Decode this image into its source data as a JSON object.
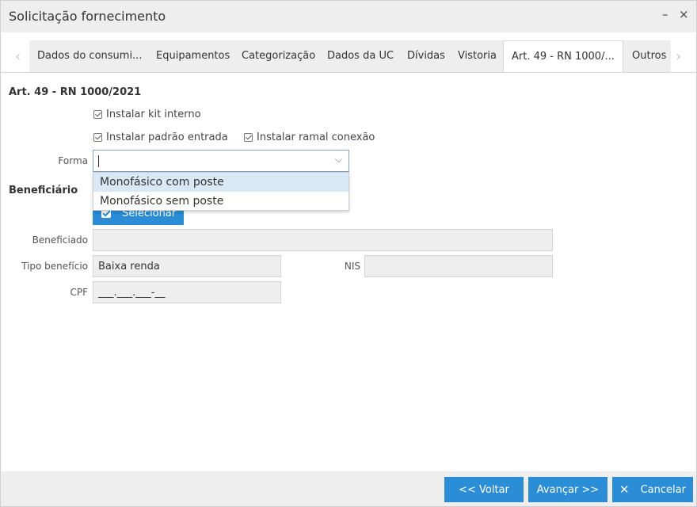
{
  "window": {
    "title": "Solicitação fornecimento",
    "minimize_glyph": "–",
    "close_glyph": "×"
  },
  "tabs": {
    "prev_glyph": "‹",
    "next_glyph": "›",
    "items": [
      {
        "label": "Dados do consumi..."
      },
      {
        "label": "Equipamentos"
      },
      {
        "label": "Categorização"
      },
      {
        "label": "Dados da UC"
      },
      {
        "label": "Dívidas"
      },
      {
        "label": "Vistoria"
      },
      {
        "label": "Art. 49 - RN 1000/..."
      },
      {
        "label": "Outros"
      }
    ],
    "active_index": 6
  },
  "art49": {
    "section_title": "Art. 49 - RN 1000/2021",
    "checkboxes": [
      {
        "label": "Instalar kit interno",
        "checked": true
      },
      {
        "label": "Instalar padrão entrada",
        "checked": true
      },
      {
        "label": "Instalar ramal conexão",
        "checked": true
      }
    ],
    "forma": {
      "label": "Forma",
      "value": "",
      "chevron_glyph": "⌵",
      "options": [
        "Monofásico com poste",
        "Monofásico sem poste"
      ],
      "highlighted_option": 0
    }
  },
  "beneficiario": {
    "section_title": "Beneficiário",
    "select_button": "Selecionar",
    "beneficiado": {
      "label": "Beneficiado",
      "value": ""
    },
    "tipo_beneficio": {
      "label": "Tipo benefício",
      "value": "Baixa renda"
    },
    "nis": {
      "label": "NIS",
      "value": ""
    },
    "cpf": {
      "label": "CPF",
      "value": "___.___.___-__"
    }
  },
  "footer": {
    "back_button": "<< Voltar",
    "next_button": "Avançar >>",
    "cancel_button": "Cancelar",
    "cancel_glyph": "✕"
  },
  "colors": {
    "primary": "#2a8dd6",
    "dropdown_highlight": "#d9e8f5",
    "field_bg": "#eeeeee"
  }
}
